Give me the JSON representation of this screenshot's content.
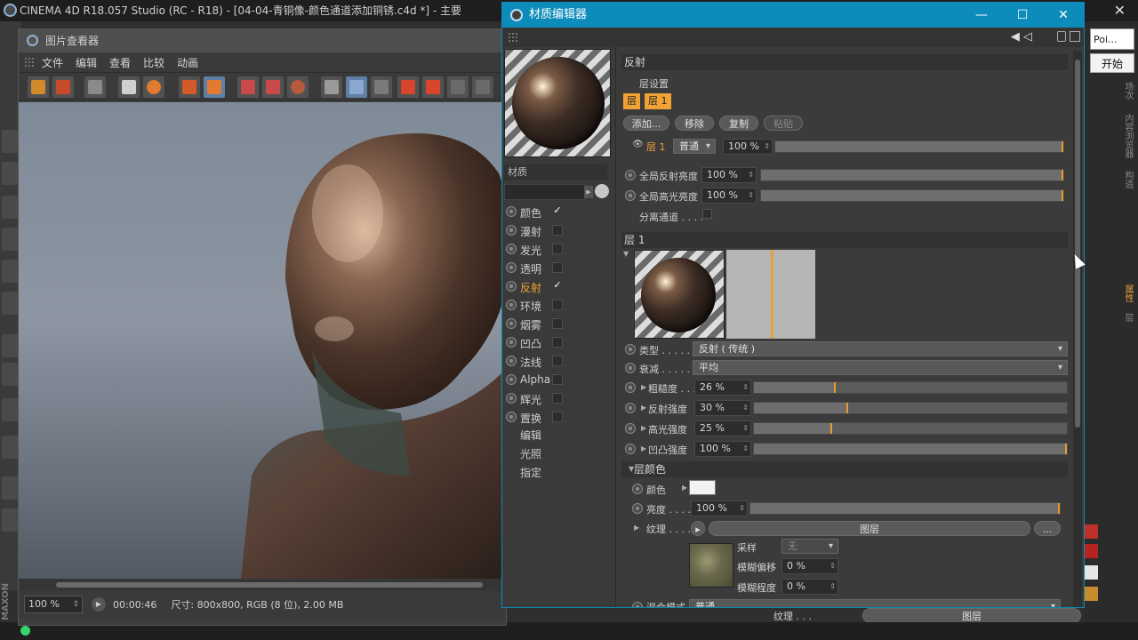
{
  "main_window": {
    "title": "CINEMA 4D R18.057 Studio (RC - R18) - [04-04-青铜像-颜色通道添加铜锈.c4d *] - 主要",
    "close_glyph": "✕"
  },
  "right_strip": {
    "poi_text": "Poi...",
    "start_button": "开始",
    "vtabs": [
      "场次",
      "内容浏览器",
      "构造",
      "属性",
      "层"
    ],
    "texture_label": "纹理 . . .",
    "texture_layer_button": "图层",
    "sample_label": "采样"
  },
  "image_viewer": {
    "title": "图片查看器",
    "menu": [
      "文件",
      "编辑",
      "查看",
      "比较",
      "动画"
    ],
    "zoom": "100 %",
    "time": "00:00:46",
    "info": "尺寸: 800x800, RGB (8 位), 2.00 MB"
  },
  "material_editor": {
    "title": "材质编辑器",
    "material_label": "材质",
    "channels": [
      {
        "label": "颜色",
        "checked": true,
        "active": false
      },
      {
        "label": "漫射",
        "checked": false,
        "active": false
      },
      {
        "label": "发光",
        "checked": false,
        "active": false
      },
      {
        "label": "透明",
        "checked": false,
        "active": false
      },
      {
        "label": "反射",
        "checked": true,
        "active": true
      },
      {
        "label": "环境",
        "checked": false,
        "active": false
      },
      {
        "label": "烟雾",
        "checked": false,
        "active": false
      },
      {
        "label": "凹凸",
        "checked": false,
        "active": false
      },
      {
        "label": "法线",
        "checked": false,
        "active": false
      },
      {
        "label": "Alpha",
        "checked": false,
        "active": false
      },
      {
        "label": "辉光",
        "checked": false,
        "active": false
      },
      {
        "label": "置换",
        "checked": false,
        "active": false
      }
    ],
    "extras": [
      "编辑",
      "光照",
      "指定"
    ],
    "reflection": {
      "section_title": "反射",
      "layer_settings_label": "层设置",
      "layer_tab": "层",
      "layer_1_tab": "层 1",
      "buttons": {
        "add": "添加...",
        "remove": "移除",
        "copy": "复制",
        "paste": "粘贴"
      },
      "layer_row": {
        "name": "层 1",
        "mode": "普通",
        "value": "100 %",
        "level": 1.0
      },
      "global_reflection": {
        "label": "全局反射亮度",
        "value": "100 %",
        "level": 1.0
      },
      "global_specular": {
        "label": "全局高光亮度",
        "value": "100 %",
        "level": 1.0
      },
      "separate_pass": "分离通道 . . . ."
    },
    "layer1": {
      "section_title": "层 1",
      "type": {
        "label": "类型 . . . . .",
        "value": "反射 ( 传统 )"
      },
      "attenuation": {
        "label": "衰减 . . . . .",
        "value": "平均"
      },
      "roughness": {
        "label": "粗糙度 . . .",
        "value": "26 %",
        "level": 0.26
      },
      "reflection_strength": {
        "label": "反射强度",
        "value": "30 %",
        "level": 0.3
      },
      "specular_strength": {
        "label": "高光强度",
        "value": "25 %",
        "level": 0.25
      },
      "bump_strength": {
        "label": "凹凸强度",
        "value": "100 %",
        "level": 1.0
      },
      "layer_color_head": "层颜色",
      "color_label": "颜色",
      "brightness": {
        "label": "亮度 . . . .",
        "value": "100 %",
        "level": 1.0
      },
      "texture": {
        "label": "纹理 . . . .",
        "button": "图层",
        "more": "..."
      },
      "sampling": {
        "label": "采样",
        "value": "无"
      },
      "blur_offset": {
        "label": "模糊偏移",
        "value": "0 %"
      },
      "blur_amount": {
        "label": "模糊程度",
        "value": "0 %"
      },
      "blend_mode": {
        "label": "混合模式",
        "value": "普通"
      }
    }
  },
  "colors": {
    "accent": "#f0a235",
    "title_blue": "#0d8cbb",
    "bronze": "#5a3f30"
  }
}
